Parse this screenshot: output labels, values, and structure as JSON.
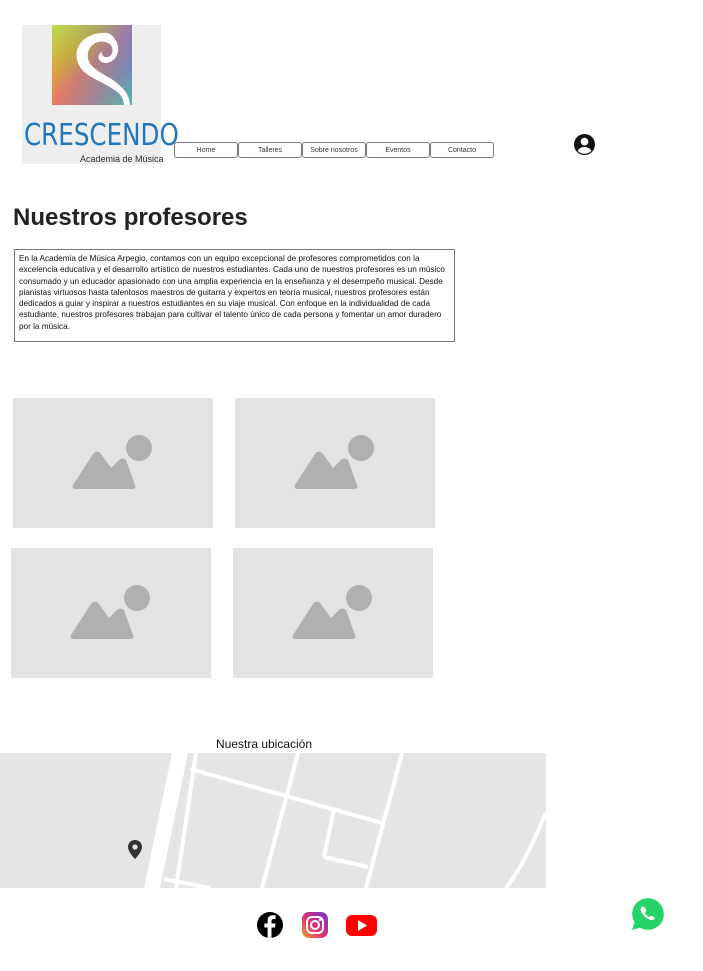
{
  "brand": {
    "name": "CRESCENDO",
    "subtitle": "Academia de Música"
  },
  "nav": {
    "items": [
      "Home",
      "Talleres",
      "Sobre nosotros",
      "Eventos",
      "Contacto"
    ]
  },
  "header": {
    "user_icon": "account-circle-icon"
  },
  "main": {
    "title": "Nuestros profesores",
    "intro": "En la Academia de Música Arpegio, contamos con un equipo excepcional de profesores comprometidos con la excelencia educativa y el desarrollo artístico de nuestros estudiantes. Cada uno de nuestros profesores es un músico consumado y un educador apasionado con una amplia experiencia en la enseñanza y el desempeño musical. Desde pianistas virtuosos hasta talentosos maestros de guitarra y expertos en teoría musical, nuestros profesores están dedicados a guiar y inspirar a nuestros estudiantes en su viaje musical. Con enfoque en la individualidad de cada estudiante, nuestros profesores trabajan para cultivar el talento único de cada persona y fomentar un amor duradero por la música.",
    "image_placeholder_icon": "image-placeholder-icon"
  },
  "location": {
    "title": "Nuestra ubicación",
    "marker_icon": "map-pin-icon"
  },
  "footer": {
    "social_icons": [
      "facebook-icon",
      "instagram-icon",
      "youtube-icon"
    ],
    "chat_icon": "whatsapp-icon"
  },
  "colors": {
    "brand_blue": "#2077be",
    "placeholder_bg": "#e3e3e3",
    "placeholder_shape": "#b0b0b0",
    "facebook": "#000000",
    "youtube": "#ff0000",
    "whatsapp": "#25d366"
  }
}
